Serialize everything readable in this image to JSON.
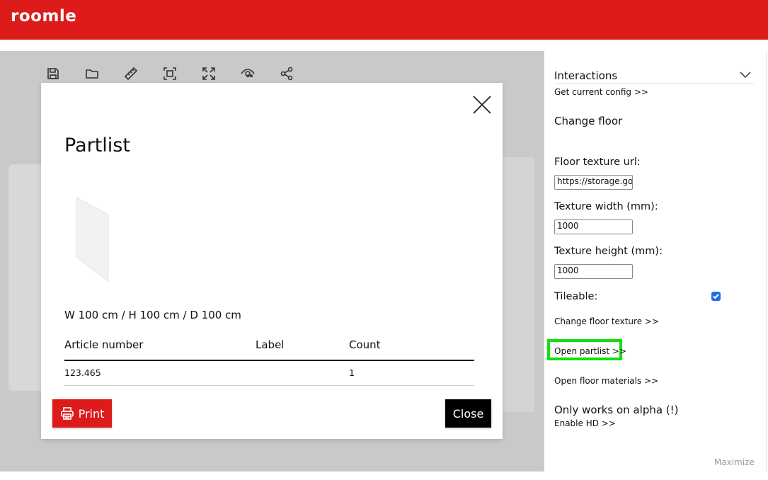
{
  "header": {
    "logo_text": "roomle",
    "brand_color": "#dd1b1b"
  },
  "toolbar": {
    "icons": [
      "save-icon",
      "folder-icon",
      "ruler-icon",
      "fit-view-icon",
      "fullscreen-icon",
      "ar-eye-icon",
      "share-icon"
    ]
  },
  "modal": {
    "title": "Partlist",
    "dimensions": "W 100 cm / H 100 cm / D 100 cm",
    "columns": [
      "Article number",
      "Label",
      "Count"
    ],
    "rows": [
      {
        "article_number": "123.465",
        "label": "",
        "count": "1"
      }
    ],
    "print_label": "Print",
    "close_label": "Close"
  },
  "sidebar": {
    "section_title": "Interactions",
    "get_config_label": "Get current config >>",
    "change_floor_heading": "Change floor",
    "floor_texture_url_label": "Floor texture url:",
    "floor_texture_url_value": "https://storage.googleapis.com",
    "texture_width_label": "Texture width (mm):",
    "texture_width_value": "1000",
    "texture_height_label": "Texture height (mm):",
    "texture_height_value": "1000",
    "tileable_label": "Tileable:",
    "tileable_checked": true,
    "change_floor_texture_label": "Change floor texture >>",
    "open_partlist_label": "Open partlist >>",
    "open_floor_materials_label": "Open floor materials >>",
    "alpha_heading": "Only works on alpha (!)",
    "enable_hd_label": "Enable HD >>",
    "maximize_label": "Maximize",
    "highlight_color": "#10e010",
    "checkbox_color": "#1f6ee8"
  }
}
